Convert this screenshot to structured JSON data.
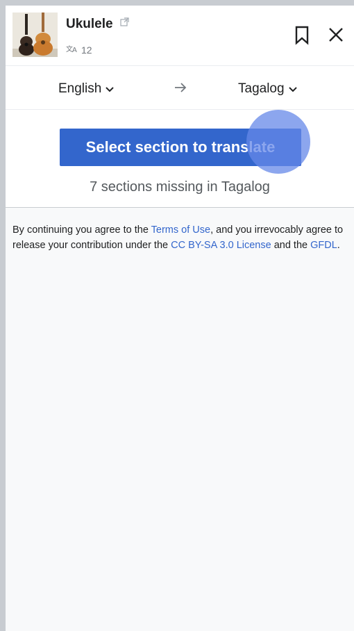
{
  "header": {
    "title": "Ukulele",
    "language_count": "12",
    "thumbnail_icon": "ukulele-photo",
    "external_link_icon": "external-link-icon",
    "bookmark_icon": "bookmark-icon",
    "close_icon": "close-icon"
  },
  "languages": {
    "source": "English",
    "target": "Tagalog"
  },
  "action": {
    "button_label": "Select section to translate",
    "missing_text": "7 sections missing in Tagalog"
  },
  "legal": {
    "part1": "By continuing you agree to the ",
    "terms_link": "Terms of Use",
    "part2": ", and you irrevocably agree to release your contribution under the ",
    "license_link": "CC BY-SA 3.0 License",
    "part3": " and the ",
    "gfdl_link": "GFDL",
    "part4": "."
  },
  "colors": {
    "accent": "#3366cc",
    "touch_indicator": "#6688e8",
    "panel_background": "#f8f9fa",
    "frame": "#c8ccd1"
  }
}
